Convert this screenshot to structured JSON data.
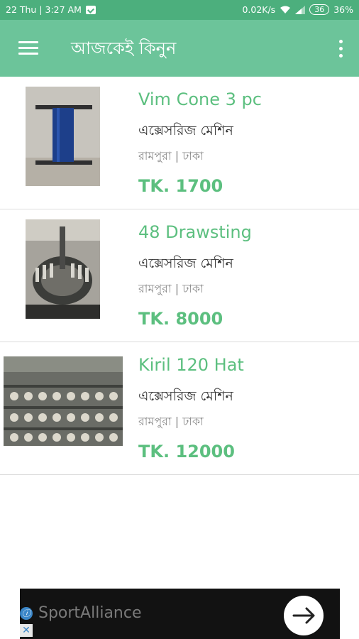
{
  "status_bar": {
    "datetime": "22 Thu | 3:27 AM",
    "speed": "0.02K/s",
    "battery_level": "36",
    "battery_percent": "36%"
  },
  "app_bar": {
    "title": "আজকেই কিনুন",
    "menu_icon": "hamburger-menu-icon",
    "overflow_icon": "more-vertical-icon"
  },
  "listings": [
    {
      "name": "Vim Cone 3 pc",
      "category": "এক্সেসরিজ মেশিন",
      "location": "রামপুরা | ঢাকা",
      "price": "TK. 1700"
    },
    {
      "name": "48 Drawsting",
      "category": "এক্সেসরিজ মেশিন",
      "location": "রামপুরা | ঢাকা",
      "price": "TK. 8000"
    },
    {
      "name": "Kiril 120 Hat",
      "category": "এক্সেসরিজ মেশিন",
      "location": "রামপুরা | ঢাকা",
      "price": "TK. 12000"
    }
  ],
  "ad": {
    "text": "SportAlliance",
    "info_icon": "ⓘ",
    "close_icon": "✕"
  }
}
